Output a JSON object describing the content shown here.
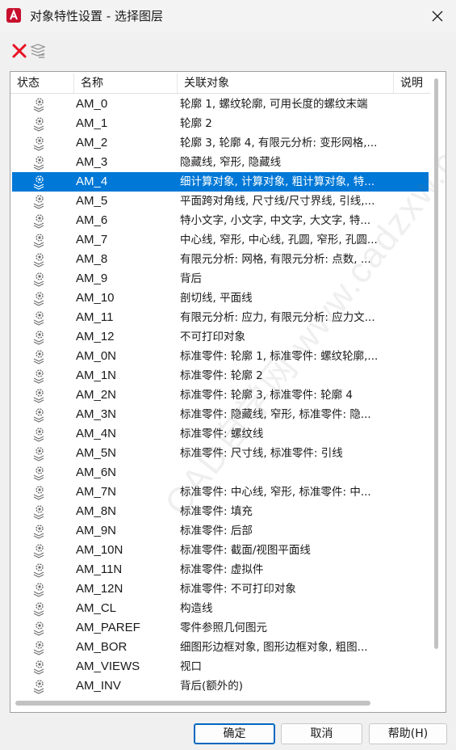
{
  "window": {
    "title": "对象特性设置 - 选择图层",
    "app_icon": "autocad-logo-icon",
    "close_icon": "close-icon"
  },
  "toolbar": {
    "delete_icon": "red-x-delete-icon",
    "purge_icon": "layer-purge-icon"
  },
  "columns": {
    "status": "状态",
    "name": "名称",
    "objects": "关联对象",
    "description": "说明"
  },
  "rows": [
    {
      "name": "AM_0",
      "objects": "轮廓 1, 螺纹轮廓, 可用长度的螺纹末端",
      "selected": false
    },
    {
      "name": "AM_1",
      "objects": "轮廓 2",
      "selected": false
    },
    {
      "name": "AM_2",
      "objects": "轮廓 3, 轮廓 4, 有限元分析: 变形网格,...",
      "selected": false
    },
    {
      "name": "AM_3",
      "objects": "隐藏线, 窄形, 隐藏线",
      "selected": false
    },
    {
      "name": "AM_4",
      "objects": "细计算对象, 计算对象, 粗计算对象, 特...",
      "selected": true
    },
    {
      "name": "AM_5",
      "objects": "平面跨对角线, 尺寸线/尺寸界线, 引线,...",
      "selected": false
    },
    {
      "name": "AM_6",
      "objects": "特小文字, 小文字, 中文字, 大文字, 特...",
      "selected": false
    },
    {
      "name": "AM_7",
      "objects": "中心线, 窄形, 中心线, 孔圆, 窄形, 孔圆...",
      "selected": false
    },
    {
      "name": "AM_8",
      "objects": "有限元分析: 网格, 有限元分析: 点数, ...",
      "selected": false
    },
    {
      "name": "AM_9",
      "objects": "背后",
      "selected": false
    },
    {
      "name": "AM_10",
      "objects": "剖切线, 平面线",
      "selected": false
    },
    {
      "name": "AM_11",
      "objects": "有限元分析: 应力, 有限元分析: 应力文...",
      "selected": false
    },
    {
      "name": "AM_12",
      "objects": "不可打印对象",
      "selected": false
    },
    {
      "name": "AM_0N",
      "objects": "标准零件: 轮廓 1, 标准零件: 螺纹轮廓,...",
      "selected": false
    },
    {
      "name": "AM_1N",
      "objects": "标准零件: 轮廓 2",
      "selected": false
    },
    {
      "name": "AM_2N",
      "objects": "标准零件: 轮廓 3, 标准零件: 轮廓 4",
      "selected": false
    },
    {
      "name": "AM_3N",
      "objects": "标准零件: 隐藏线, 窄形, 标准零件: 隐...",
      "selected": false
    },
    {
      "name": "AM_4N",
      "objects": "标准零件: 螺纹线",
      "selected": false
    },
    {
      "name": "AM_5N",
      "objects": "标准零件: 尺寸线, 标准零件: 引线",
      "selected": false
    },
    {
      "name": "AM_6N",
      "objects": "",
      "selected": false
    },
    {
      "name": "AM_7N",
      "objects": "标准零件: 中心线, 窄形, 标准零件: 中...",
      "selected": false
    },
    {
      "name": "AM_8N",
      "objects": "标准零件: 填充",
      "selected": false
    },
    {
      "name": "AM_9N",
      "objects": "标准零件: 后部",
      "selected": false
    },
    {
      "name": "AM_10N",
      "objects": "标准零件: 截面/视图平面线",
      "selected": false
    },
    {
      "name": "AM_11N",
      "objects": "标准零件: 虚拟件",
      "selected": false
    },
    {
      "name": "AM_12N",
      "objects": "标准零件: 不可打印对象",
      "selected": false
    },
    {
      "name": "AM_CL",
      "objects": "构造线",
      "selected": false
    },
    {
      "name": "AM_PAREF",
      "objects": "零件参照几何图元",
      "selected": false
    },
    {
      "name": "AM_BOR",
      "objects": "细图形边框对象, 图形边框对象, 粗图...",
      "selected": false
    },
    {
      "name": "AM_VIEWS",
      "objects": "视口",
      "selected": false
    },
    {
      "name": "AM_INV",
      "objects": "背后(额外的)",
      "selected": false
    }
  ],
  "row_icon": "layer-gear-icon",
  "watermark": "CAD自学网 www.cadzxw.com",
  "buttons": {
    "ok": "确定",
    "cancel": "取消",
    "help": "帮助(H)"
  },
  "colors": {
    "selection": "#0078d7",
    "delete_red": "#e81123",
    "autocad_red": "#c8102e"
  }
}
